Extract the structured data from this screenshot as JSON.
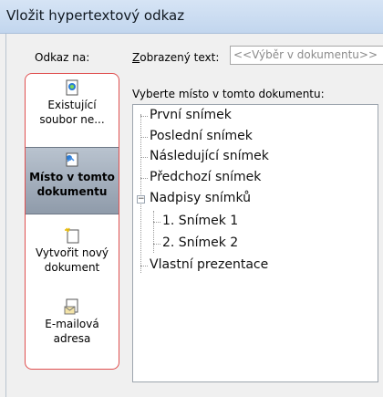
{
  "window": {
    "title": "Vložit hypertextový odkaz"
  },
  "link_to": {
    "label": "Odkaz na:",
    "options": [
      {
        "label_line1": "Existující",
        "label_line2": "soubor ne...",
        "icon": "existing-file-icon",
        "selected": false
      },
      {
        "label_line1": "Místo v tomto",
        "label_line2": "dokumentu",
        "icon": "place-in-document-icon",
        "selected": true
      },
      {
        "label_line1": "Vytvořit nový",
        "label_line2": "dokument",
        "icon": "new-document-icon",
        "selected": false
      },
      {
        "label_line1": "E-mailová",
        "label_line2": "adresa",
        "icon": "email-address-icon",
        "selected": false
      }
    ]
  },
  "display_text": {
    "label": "Zobrazený text:",
    "value": "<<Výběr v dokumentu>>"
  },
  "document_places": {
    "label": "Vyberte místo v tomto dokumentu:",
    "items": [
      {
        "text": "První snímek"
      },
      {
        "text": "Poslední snímek"
      },
      {
        "text": "Následující snímek"
      },
      {
        "text": "Předchozí snímek"
      },
      {
        "text": "Nadpisy snímků"
      },
      {
        "text": "1. Snímek 1"
      },
      {
        "text": "2. Snímek 2"
      },
      {
        "text": "Vlastní prezentace"
      }
    ]
  },
  "colors": {
    "titlebar": "#c8dbf1",
    "selection_border": "#e05050",
    "selected_place": "#9aa6b5"
  }
}
